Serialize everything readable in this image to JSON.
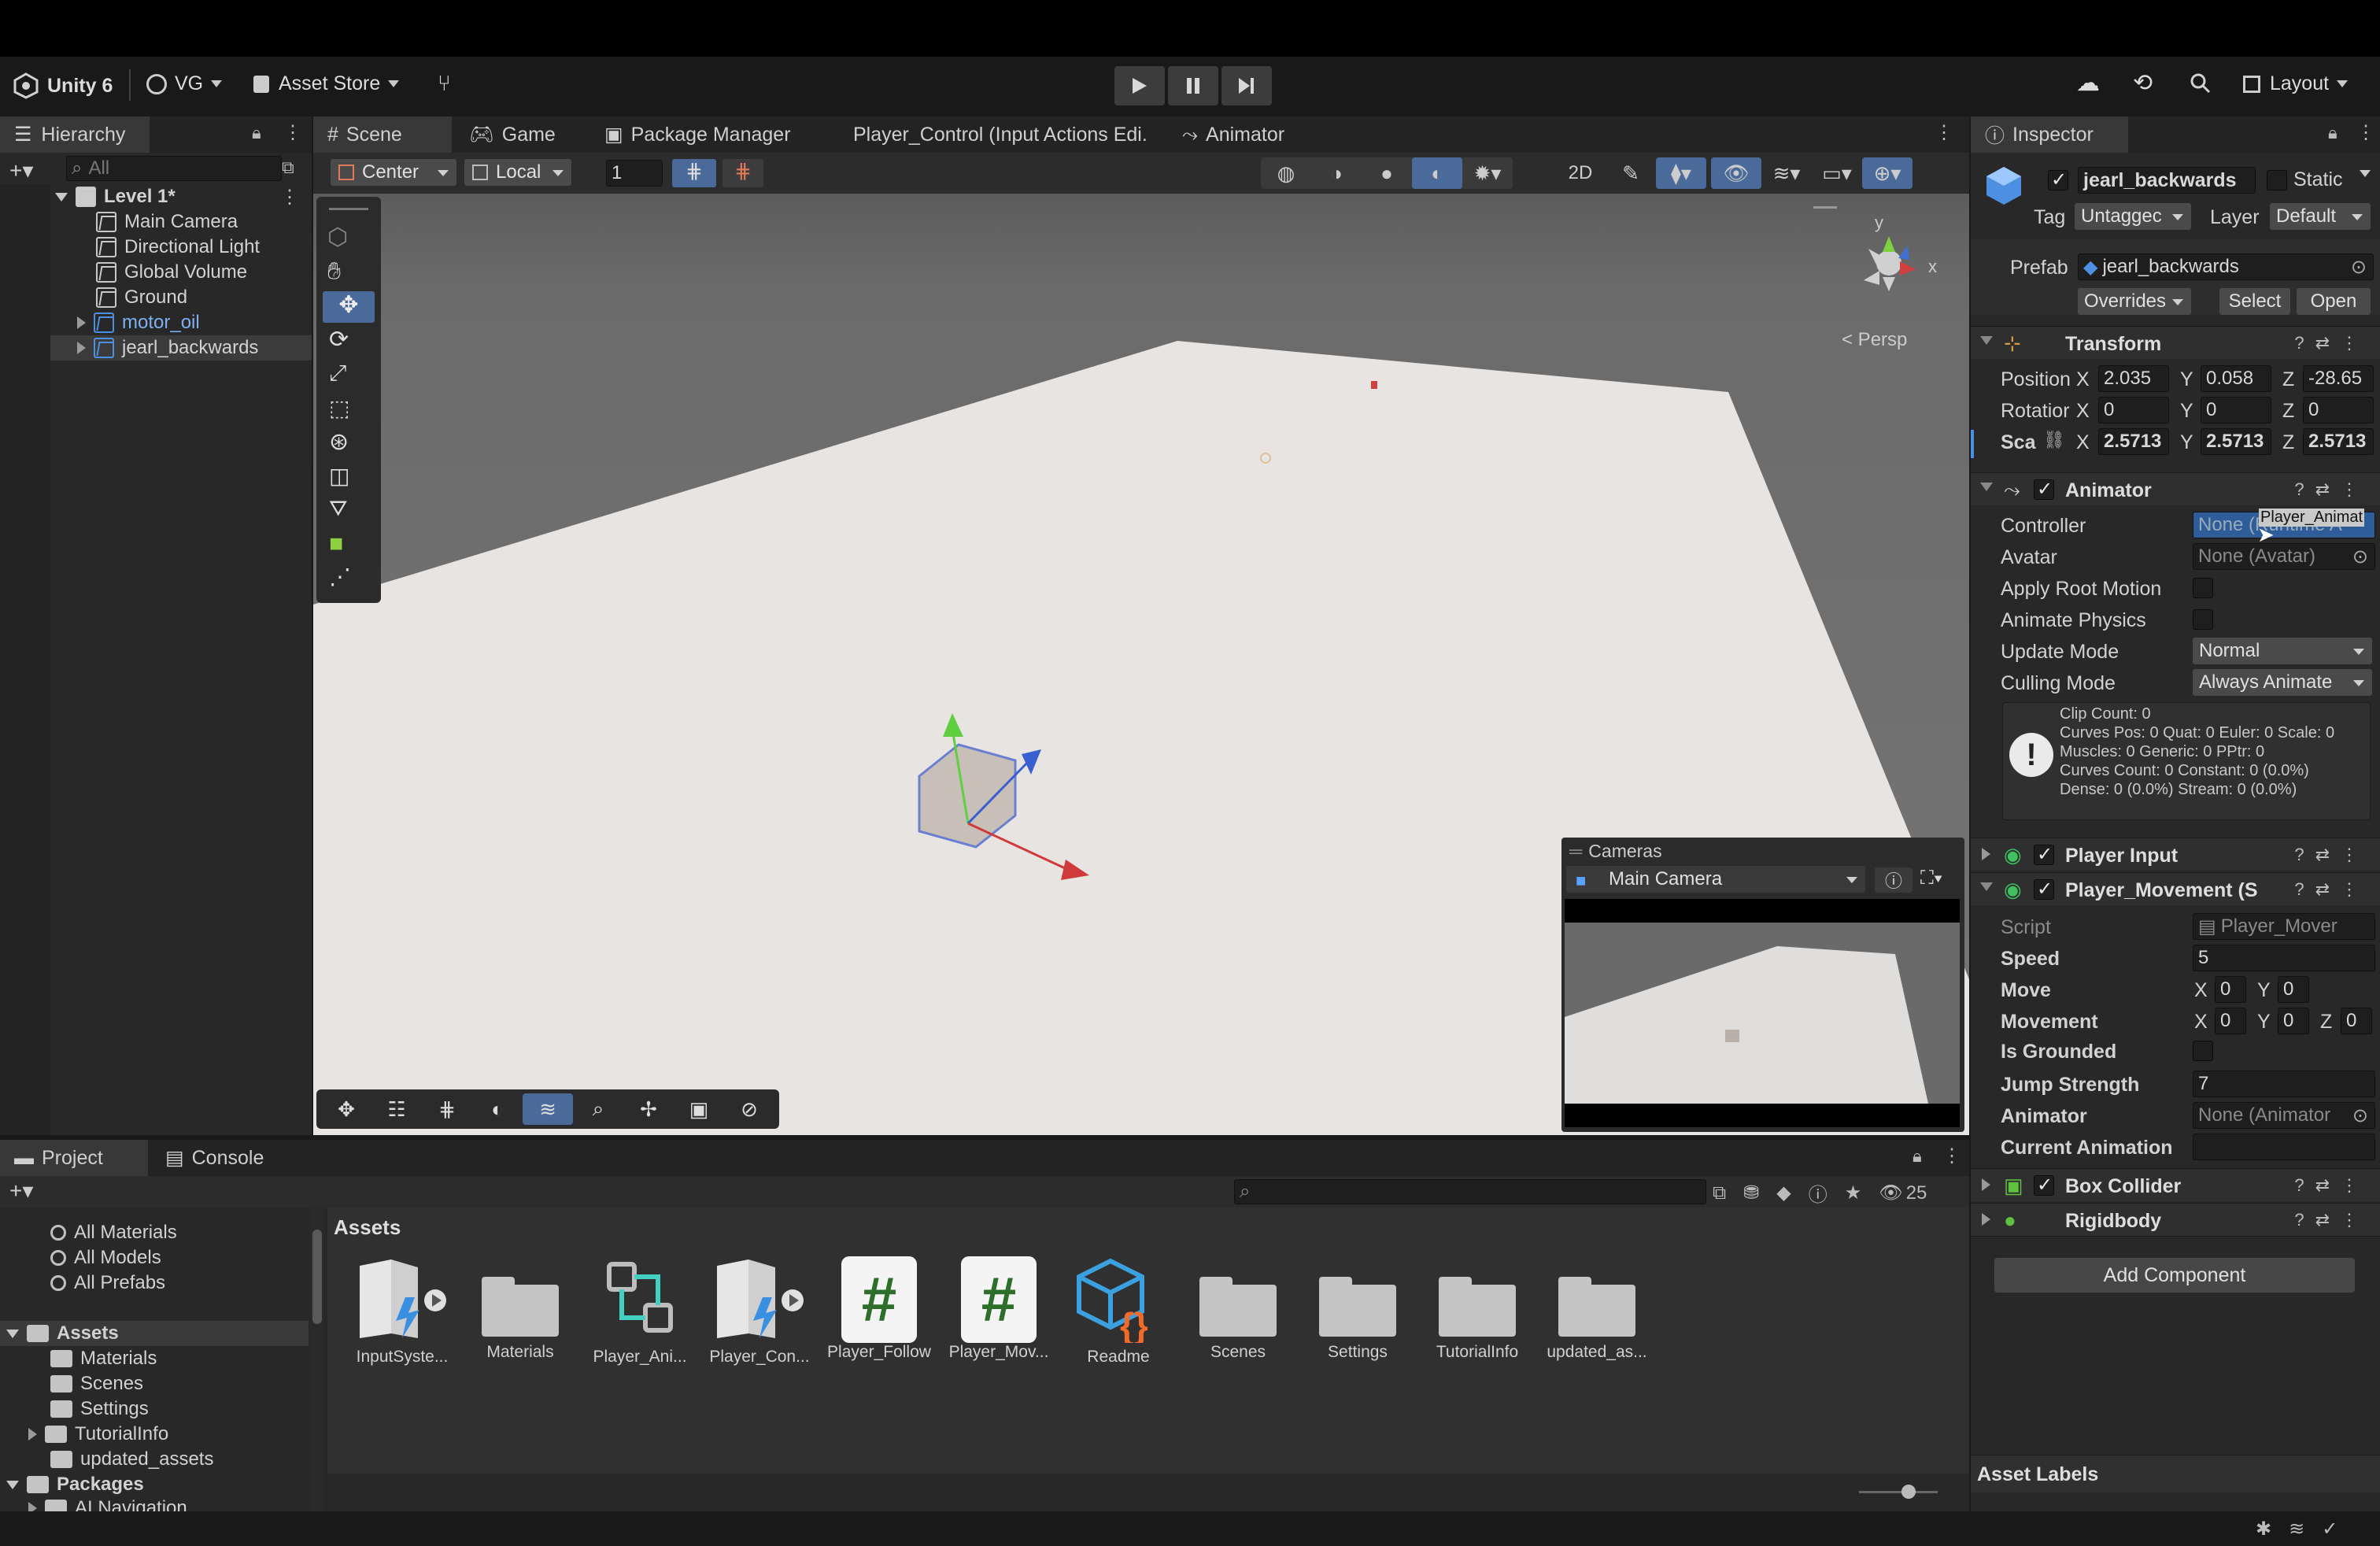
{
  "toolbar": {
    "app": "Unity 6",
    "account": "VG",
    "asset_store": "Asset Store",
    "layout": "Layout"
  },
  "tabs": {
    "hierarchy": "Hierarchy",
    "scene": "Scene",
    "game": "Game",
    "package_manager": "Package Manager",
    "player_control": "Player_Control (Input Actions Edi.",
    "animator": "Animator",
    "inspector": "Inspector",
    "project": "Project",
    "console": "Console"
  },
  "hierarchy": {
    "search_placeholder": "All",
    "scene_name": "Level 1*",
    "items": [
      "Main Camera",
      "Directional Light",
      "Global Volume",
      "Ground",
      "motor_oil",
      "jearl_backwards"
    ]
  },
  "scene": {
    "pivot": "Center",
    "space": "Local",
    "grid_value": "1",
    "persp": "< Persp",
    "gizmo_y": "y",
    "gizmo_x": "x",
    "cameras_title": "Cameras",
    "cameras_selected": "Main Camera"
  },
  "inspector": {
    "object_name": "jearl_backwards",
    "static_label": "Static",
    "tag_label": "Tag",
    "tag_value": "Untaggec",
    "layer_label": "Layer",
    "layer_value": "Default",
    "prefab_label": "Prefab",
    "prefab_value": "jearl_backwards",
    "overrides": "Overrides",
    "select": "Select",
    "open": "Open",
    "transform": {
      "title": "Transform",
      "position_label": "Position",
      "rotation_label": "Rotatior",
      "scale_label": "Sca",
      "position": [
        "2.035",
        "0.058",
        "-28.65"
      ],
      "rotation": [
        "0",
        "0",
        "0"
      ],
      "scale": [
        "2.5713",
        "2.5713",
        "2.5713"
      ]
    },
    "animator": {
      "title": "Animator",
      "controller_label": "Controller",
      "controller_value": "None (Runtime A",
      "tooltip": "Player_Animat",
      "avatar_label": "Avatar",
      "avatar_value": "None (Avatar)",
      "apply_root_motion": "Apply Root Motion",
      "animate_physics": "Animate Physics",
      "update_mode_label": "Update Mode",
      "update_mode_value": "Normal",
      "culling_mode_label": "Culling Mode",
      "culling_mode_value": "Always Animate",
      "info": [
        "Clip Count: 0",
        "Curves Pos: 0 Quat: 0 Euler: 0 Scale: 0",
        "Muscles: 0 Generic: 0 PPtr: 0",
        "Curves Count: 0 Constant: 0 (0.0%)",
        "Dense: 0 (0.0%) Stream: 0 (0.0%)"
      ]
    },
    "player_input": "Player Input",
    "player_movement": {
      "title": "Player_Movement (S",
      "script_label": "Script",
      "script_value": "Player_Mover",
      "speed_label": "Speed",
      "speed_value": "5",
      "move_label": "Move",
      "move": [
        "0",
        "0"
      ],
      "movement_label": "Movement",
      "movement": [
        "0",
        "0",
        "0"
      ],
      "is_grounded_label": "Is Grounded",
      "jump_label": "Jump Strength",
      "jump_value": "7",
      "animator_label": "Animator",
      "animator_value": "None (Animator",
      "current_anim_label": "Current Animation"
    },
    "box_collider": "Box Collider",
    "rigidbody": "Rigidbody",
    "add_component": "Add Component",
    "asset_labels": "Asset Labels"
  },
  "project": {
    "favorites": [
      "All Materials",
      "All Models",
      "All Prefabs"
    ],
    "assets_root": "Assets",
    "asset_folders": [
      "Materials",
      "Scenes",
      "Settings",
      "TutorialInfo",
      "updated_assets"
    ],
    "packages_root": "Packages",
    "packages": [
      "AI Navigation"
    ],
    "breadcrumb": "Assets",
    "hidden_count": "25",
    "assets": [
      "InputSyste...",
      "Materials",
      "Player_Ani...",
      "Player_Con...",
      "Player_Follow",
      "Player_Mov...",
      "Readme",
      "Scenes",
      "Settings",
      "TutorialInfo",
      "updated_as..."
    ]
  }
}
